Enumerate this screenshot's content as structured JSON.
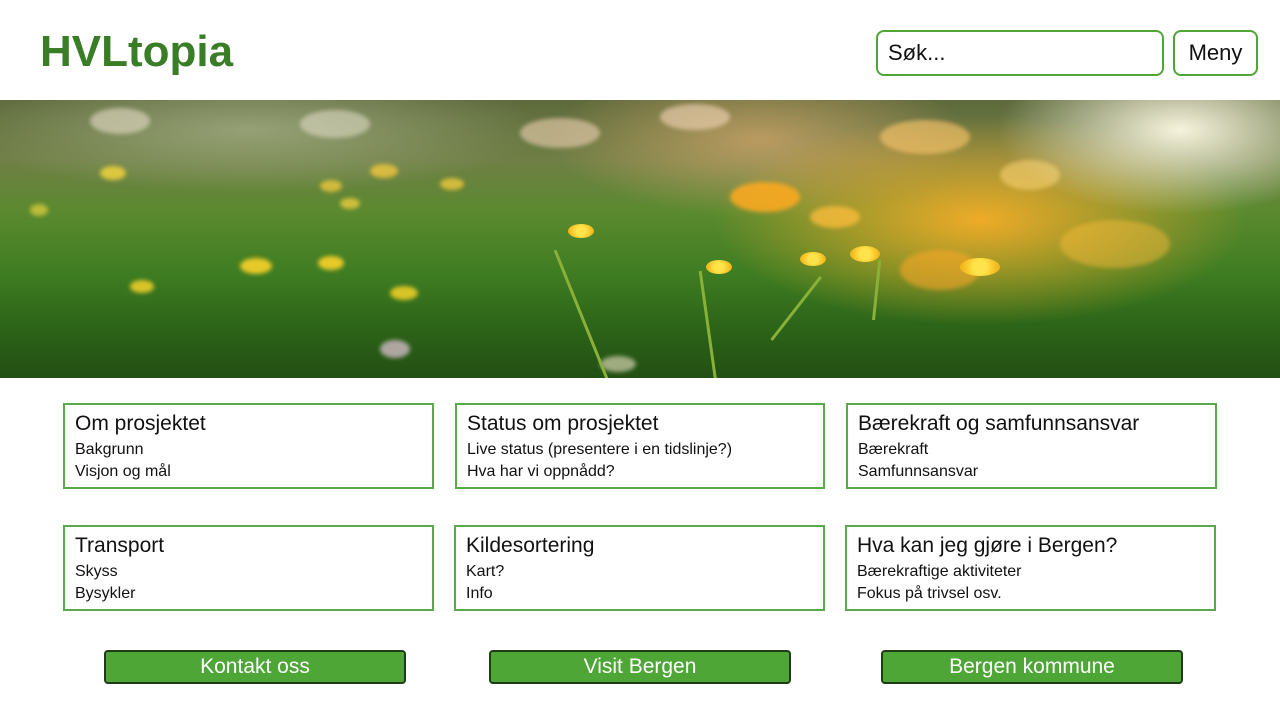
{
  "header": {
    "logo": "HVLtopia",
    "search_placeholder": "Søk...",
    "menu_label": "Meny"
  },
  "hero": {
    "image": "meadow-with-yellow-flowers-sunset"
  },
  "cards": [
    {
      "title": "Om prosjektet",
      "items": [
        "Bakgrunn",
        "Visjon og mål"
      ]
    },
    {
      "title": "Status om prosjektet",
      "items": [
        "Live status (presentere i en tidslinje?)",
        "Hva har vi oppnådd?"
      ]
    },
    {
      "title": "Bærekraft og samfunnsansvar",
      "items": [
        "Bærekraft",
        "Samfunnsansvar"
      ]
    },
    {
      "title": "Transport",
      "items": [
        "Skyss",
        "Bysykler"
      ]
    },
    {
      "title": "Kildesortering",
      "items": [
        "Kart?",
        "Info"
      ]
    },
    {
      "title": "Hva kan jeg gjøre i Bergen?",
      "items": [
        "Bærekraftige aktiviteter",
        "Fokus på trivsel osv."
      ]
    }
  ],
  "footer_buttons": {
    "contact": "Kontakt oss",
    "visit": "Visit Bergen",
    "municipality": "Bergen kommune"
  },
  "colors": {
    "brand_green": "#3a7d27",
    "border_green": "#4ea637",
    "button_green": "#4ea637"
  }
}
